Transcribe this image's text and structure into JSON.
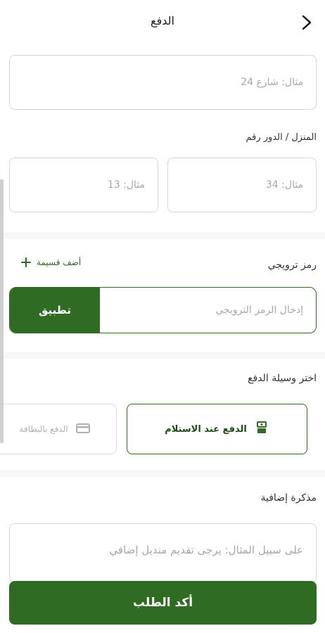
{
  "header": {
    "title": "الدفع",
    "back_icon": "chevron-right-icon"
  },
  "address": {
    "street_placeholder": "مثال: شارع 24",
    "house_floor_label": "المنزل / الدور رقم",
    "house_placeholder": "مثال: 34",
    "floor_placeholder": "مثال: 13"
  },
  "promo": {
    "label": "رمز ترويجي",
    "add_voucher_label": "أضف قسيمة",
    "input_placeholder": "إدخال الرمز الترويجي",
    "apply_label": "تطبيق"
  },
  "payment": {
    "section_label": "اختر وسيلة الدفع",
    "options": [
      {
        "label": "الدفع عند الاستلام",
        "icon": "cash-icon",
        "selected": true
      },
      {
        "label": "الدفع بالبطاقة",
        "icon": "card-icon",
        "selected": false
      }
    ]
  },
  "note": {
    "label": "مذكرة إضافية",
    "placeholder": "على سبيل المثال: يرجى تقديم منديل إضافي"
  },
  "confirm": {
    "label": "أكد الطلب"
  },
  "colors": {
    "brand": "#2f6b22",
    "border": "#d6d6d6"
  }
}
